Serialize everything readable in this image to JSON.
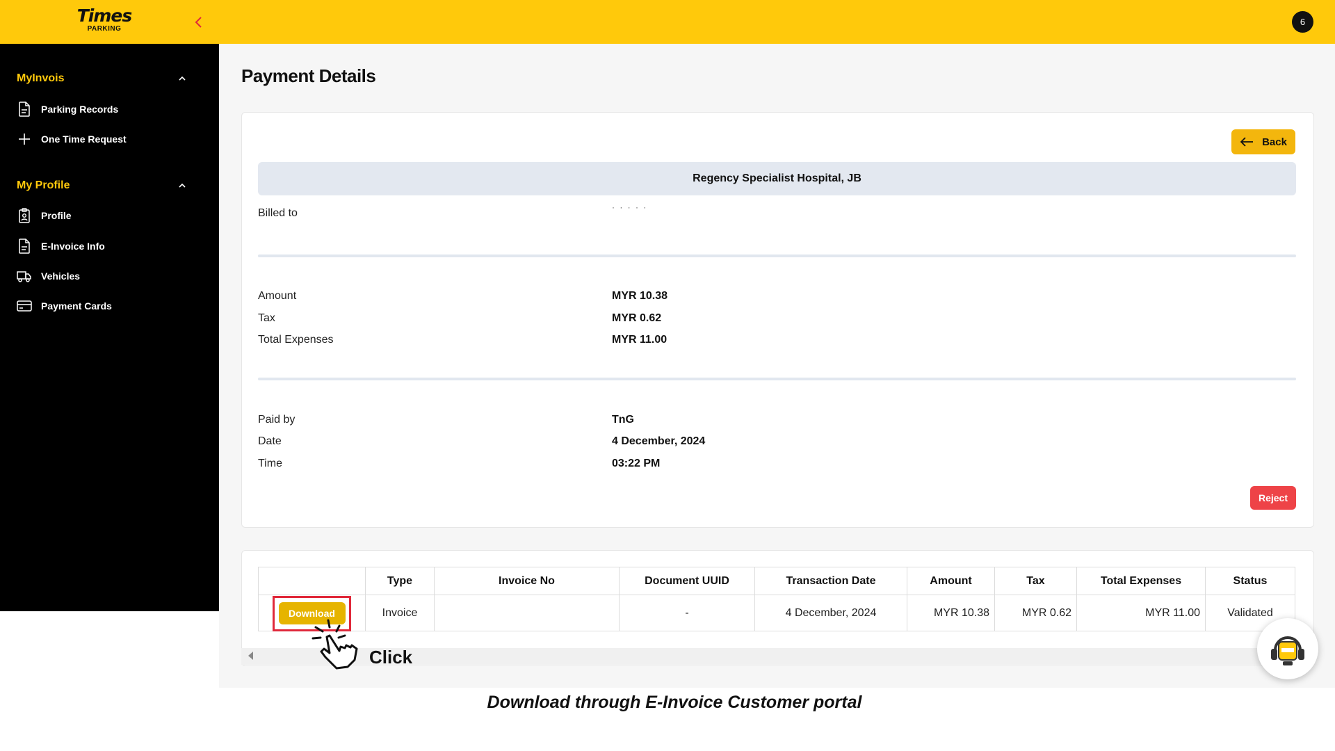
{
  "brand": {
    "name": "Times",
    "sub": "PARKING"
  },
  "header": {
    "notification_count": "6"
  },
  "sidebar": {
    "sections": [
      {
        "title": "MyInvois",
        "items": [
          {
            "label": "Parking Records",
            "icon": "document-icon"
          },
          {
            "label": "One Time Request",
            "icon": "plus-icon"
          }
        ]
      },
      {
        "title": "My Profile",
        "items": [
          {
            "label": "Profile",
            "icon": "id-card-icon"
          },
          {
            "label": "E-Invoice Info",
            "icon": "document-icon"
          },
          {
            "label": "Vehicles",
            "icon": "truck-icon"
          },
          {
            "label": "Payment Cards",
            "icon": "credit-card-icon"
          }
        ]
      }
    ]
  },
  "page": {
    "title": "Payment Details"
  },
  "details": {
    "back_label": "Back",
    "location": "Regency Specialist Hospital, JB",
    "billed_to_label": "Billed to",
    "billed_to_value": "· · · · ·",
    "amount_label": "Amount",
    "amount_value": "MYR 10.38",
    "tax_label": "Tax",
    "tax_value": "MYR 0.62",
    "total_label": "Total Expenses",
    "total_value": "MYR 11.00",
    "paid_by_label": "Paid by",
    "paid_by_value": "TnG",
    "date_label": "Date",
    "date_value": "4 December, 2024",
    "time_label": "Time",
    "time_value": "03:22 PM",
    "reject_label": "Reject"
  },
  "invoice_table": {
    "headers": [
      "",
      "Type",
      "Invoice No",
      "Document UUID",
      "Transaction Date",
      "Amount",
      "Tax",
      "Total Expenses",
      "Status"
    ],
    "row": {
      "action": "Download",
      "type": "Invoice",
      "invoice_no": "",
      "document_uuid": "-",
      "transaction_date": "4 December, 2024",
      "amount": "MYR 10.38",
      "tax": "MYR 0.62",
      "total": "MYR 11.00",
      "status": "Validated"
    }
  },
  "annotation": {
    "click_label": "Click"
  },
  "caption": "Download through E-Invoice Customer portal",
  "colors": {
    "brand_yellow": "#ffc90b",
    "sidebar_bg": "#000000",
    "reject_red": "#ee4347",
    "highlight_red": "#e0283a"
  }
}
